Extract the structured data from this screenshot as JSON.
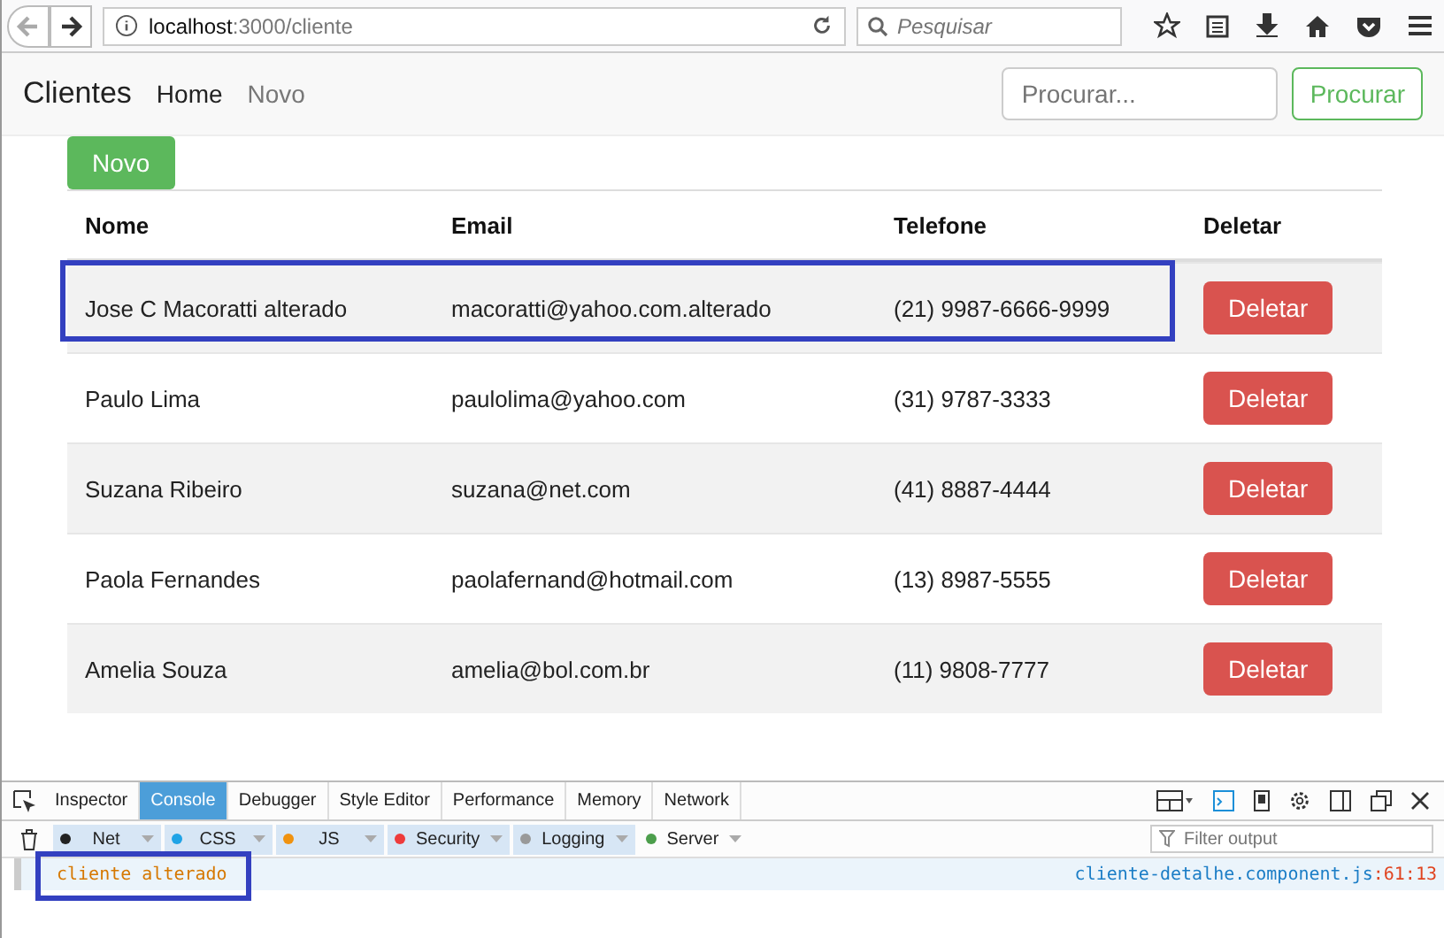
{
  "browser": {
    "url_host": "localhost",
    "url_path": ":3000/cliente",
    "search_placeholder": "Pesquisar"
  },
  "navbar": {
    "brand": "Clientes",
    "links": [
      {
        "label": "Home",
        "selected": true
      },
      {
        "label": "Novo",
        "selected": false
      }
    ],
    "search_placeholder": "Procurar...",
    "search_button": "Procurar"
  },
  "new_button": "Novo",
  "table": {
    "columns": [
      "Nome",
      "Email",
      "Telefone",
      "Deletar"
    ],
    "rows": [
      {
        "nome": "Jose C Macoratti alterado",
        "email": "macoratti@yahoo.com.alterado",
        "telefone": "(21) 9987-6666-9999",
        "action": "Deletar",
        "highlighted": true
      },
      {
        "nome": "Paulo Lima",
        "email": "paulolima@yahoo.com",
        "telefone": "(31) 9787-3333",
        "action": "Deletar",
        "highlighted": false
      },
      {
        "nome": "Suzana Ribeiro",
        "email": "suzana@net.com",
        "telefone": "(41) 8887-4444",
        "action": "Deletar",
        "highlighted": false
      },
      {
        "nome": "Paola Fernandes",
        "email": "paolafernand@hotmail.com",
        "telefone": "(13) 8987-5555",
        "action": "Deletar",
        "highlighted": false
      },
      {
        "nome": "Amelia Souza",
        "email": "amelia@bol.com.br",
        "telefone": "(11) 9808-7777",
        "action": "Deletar",
        "highlighted": false
      }
    ]
  },
  "devtools": {
    "tabs": [
      {
        "label": "Inspector",
        "selected": false
      },
      {
        "label": "Console",
        "selected": true
      },
      {
        "label": "Debugger",
        "selected": false
      },
      {
        "label": "Style Editor",
        "selected": false
      },
      {
        "label": "Performance",
        "selected": false
      },
      {
        "label": "Memory",
        "selected": false
      },
      {
        "label": "Network",
        "selected": false
      }
    ],
    "filters": [
      {
        "label": "Net",
        "color": "#222222",
        "on": true
      },
      {
        "label": "CSS",
        "color": "#1fa3e6",
        "on": true
      },
      {
        "label": "JS",
        "color": "#f0920f",
        "on": true
      },
      {
        "label": "Security",
        "color": "#ee3b3b",
        "on": true
      },
      {
        "label": "Logging",
        "color": "#999999",
        "on": true
      },
      {
        "label": "Server",
        "color": "#4c9e4c",
        "on": false
      }
    ],
    "filter_placeholder": "Filter output",
    "messages": [
      {
        "text": "cliente alterado",
        "source": "cliente-detalhe.component.js",
        "line": ":61:13",
        "highlighted": true
      }
    ]
  }
}
